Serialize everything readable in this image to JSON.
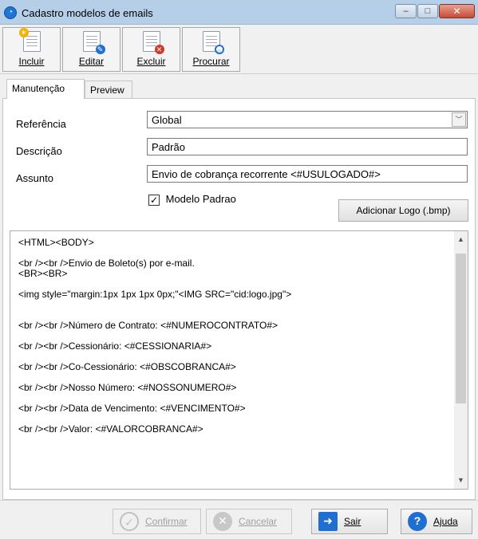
{
  "window": {
    "title": "Cadastro modelos de emails",
    "min": "–",
    "max": "□",
    "close": "✕"
  },
  "toolbar": {
    "incluir": "Incluir",
    "editar": "Editar",
    "excluir": "Excluir",
    "procurar": "Procurar"
  },
  "tabs": [
    {
      "label": "Manutenção"
    },
    {
      "label": "Preview"
    }
  ],
  "form": {
    "referencia_label": "Referência",
    "referencia_value": "Global",
    "descricao_label": "Descrição",
    "descricao_value": "Padrão",
    "assunto_label": "Assunto",
    "assunto_value": "Envio de cobrança recorrente <#USULOGADO#>",
    "modelo_padrao_label": "Modelo Padrao",
    "modelo_padrao_checked": "✓",
    "adicionar_logo": "Adicionar Logo (.bmp)"
  },
  "editor": {
    "text": "<HTML><BODY>\n\n<br /><br />Envio de Boleto(s) por e-mail.\n<BR><BR>\n\n<img style=\"margin:1px 1px 1px 0px;\"<IMG SRC=\"cid:logo.jpg\">\n\n\n<br /><br />Número de Contrato: <#NUMEROCONTRATO#>\n\n<br /><br />Cessionário: <#CESSIONARIA#>\n\n<br /><br />Co-Cessionário: <#OBSCOBRANCA#>\n\n<br /><br />Nosso Número: <#NOSSONUMERO#>\n\n<br /><br />Data de Vencimento: <#VENCIMENTO#>\n\n<br /><br />Valor: <#VALORCOBRANCA#>"
  },
  "footer": {
    "confirmar": "Confirmar",
    "cancelar": "Cancelar",
    "sair": "Sair",
    "ajuda": "Ajuda"
  },
  "icons": {
    "check_glyph": "✓",
    "x_glyph": "✕",
    "exit_glyph": "➜",
    "help_glyph": "?",
    "scroll_up": "▲",
    "scroll_down": "▼",
    "dropdown": "﹀",
    "incluir_badge": "✶",
    "excluir_badge": "✕",
    "procurar_badge": "○",
    "editar_badge": "✎"
  },
  "colors": {
    "accent": "#1f6fd1",
    "danger": "#d0392b",
    "title_bar": "#b6cfe8"
  }
}
